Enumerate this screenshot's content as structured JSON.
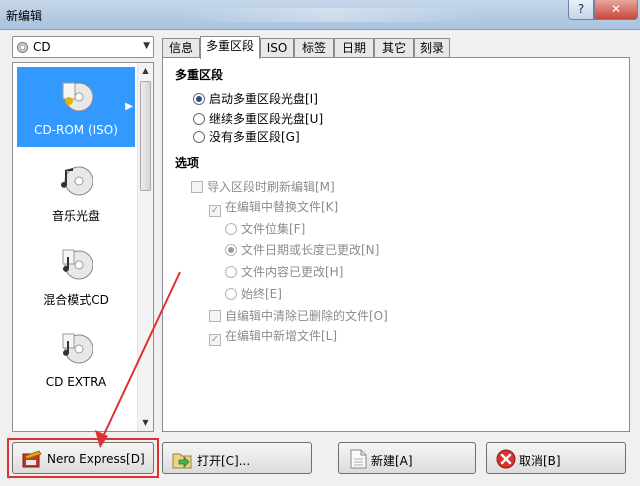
{
  "window": {
    "title": "新编辑",
    "help_label": "?",
    "close_label": "✕"
  },
  "disc_selector": {
    "value": "CD",
    "icon": "cd-disc-icon"
  },
  "side_items": [
    {
      "label": "CD-ROM (ISO)",
      "icon": "cd-rom-disc-icon"
    },
    {
      "label": "音乐光盘",
      "icon": "music-disc-icon"
    },
    {
      "label": "混合模式CD",
      "icon": "mixed-mode-disc-icon"
    },
    {
      "label": "CD EXTRA",
      "icon": "cd-extra-disc-icon"
    }
  ],
  "tabs": [
    "信息",
    "多重区段",
    "ISO",
    "标签",
    "日期",
    "其它",
    "刻录"
  ],
  "active_tab": "多重区段",
  "multisession": {
    "title": "多重区段",
    "options": [
      "启动多重区段光盘[I]",
      "继续多重区段光盘[U]",
      "没有多重区段[G]"
    ]
  },
  "options_group": {
    "title": "选项",
    "import_refresh": "导入区段时刷新编辑[M]",
    "replace_files": "在编辑中替换文件[K]",
    "replace_modes": [
      "文件位集[F]",
      "文件日期或长度已更改[N]",
      "文件内容已更改[H]",
      "始终[E]"
    ],
    "clean_deleted": "自编辑中清除已删除的文件[O]",
    "add_new": "在编辑中新增文件[L]"
  },
  "buttons": {
    "nero_express": "Nero Express[D]",
    "open": "打开[C]...",
    "new": "新建[A]",
    "cancel": "取消[B]"
  },
  "colors": {
    "selection": "#3399ff",
    "highlight": "#e03131"
  }
}
